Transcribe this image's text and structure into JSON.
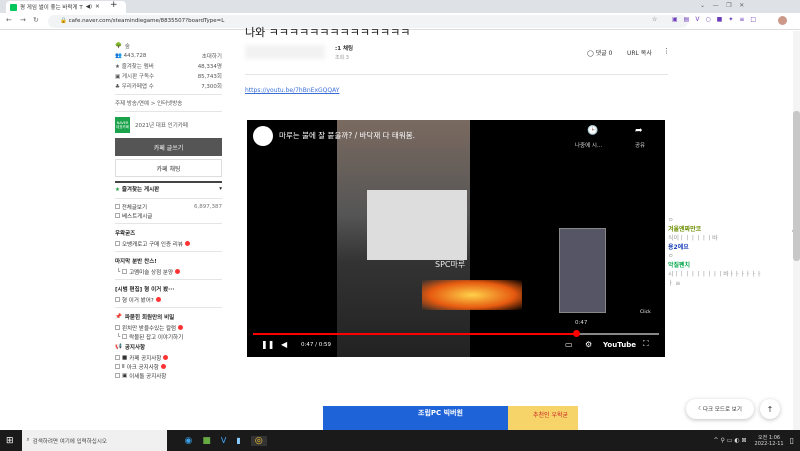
{
  "browser": {
    "tab_title": "평 게임 썰이 좋는 바락게 T",
    "url": "cafe.naver.com/steamindiegame/8835507?boardType=L"
  },
  "sidebar": {
    "cafe_name": "숲",
    "members": "443,728",
    "invite": "초대하기",
    "stats": [
      {
        "label": "즐겨찾는 멤버",
        "value": "48,334명"
      },
      {
        "label": "게시판 구독수",
        "value": "85,743회"
      },
      {
        "label": "우리카페앱 수",
        "value": "7,300회"
      }
    ],
    "theme": "주제 방송/연예 > 인터넷방송",
    "badge_text": "NAVER 대표카페",
    "award": "2021년 대표 인기카페",
    "write": "카페 글쓰기",
    "chat": "카페 채팅",
    "fav_header": "즐겨찾는 게시판",
    "all_posts": "전체글보기",
    "all_count": "6,897,387",
    "best": "베스트게시글",
    "sections": [
      {
        "title": "우왁굳즈",
        "items": [
          "오뱅캐로고 구매 인증 리뷰"
        ]
      },
      {
        "title": "마지막 분반 찬스!",
        "items": [
          "고멤미술 상점 분양"
        ]
      },
      {
        "title": "[시범 편집] 형 이거 봤···",
        "items": [
          "형 이거 봤어?"
        ]
      },
      {
        "title": "파묻힌 회원만의 비밀",
        "items": [
          "왼치만 받을수있는 칼럼",
          "락물된 잡고 이야기하기"
        ]
      },
      {
        "title": "공지사항",
        "items": [
          "카페 공지사항",
          "아크 공지사항",
          "이세돌 공지사항"
        ]
      }
    ]
  },
  "post": {
    "title": "나와 ㅋㅋㅋㅋㅋㅋㅋㅋㅋㅋㅋㅋㅋㅋ",
    "author_level": ":1 채팅",
    "views": "조회 3",
    "comments": "댓글 0",
    "url_copy": "URL 복사",
    "link": "https://youtu.be/7hBnExGQQAY"
  },
  "video": {
    "title": "마루는 불에 잘 붙을까? / 바닥재 다 태워봄.",
    "watch_later": "나중에 시...",
    "share": "공유",
    "caption": "SPC마루",
    "hover_time": "0:47",
    "time": "0:47 / 0:59",
    "progress": 0.797,
    "click": "Click",
    "youtube": "YouTube"
  },
  "chat": [
    {
      "name": "",
      "msg": "ㅇ"
    },
    {
      "name": "겨울엔짜만코",
      "msg": "식이ㅣㅣㅣㅣㅣㅣ바",
      "color": "#6b8e00"
    },
    {
      "name": "용2에요",
      "msg": "ㅇ",
      "color": "#1a3fb8"
    },
    {
      "name": "악질펜치",
      "msg": "시ㅣㅣㅣㅣㅣㅣㅣㅣㅣ바ㅏㅏㅏㅏㅏㅏ",
      "color": "#0aa84f"
    },
    {
      "name": "",
      "msg": "ㅏ ≡"
    }
  ],
  "ad": {
    "text1": "조립PC 빅버원",
    "text2": "추천인 우왁굳"
  },
  "floating": {
    "dark_mode": "다크 모드로 보기"
  },
  "taskbar": {
    "search": "검색하려면 여기에 입력하십시오",
    "time": "오전 1:06",
    "date": "2022-12-11"
  }
}
